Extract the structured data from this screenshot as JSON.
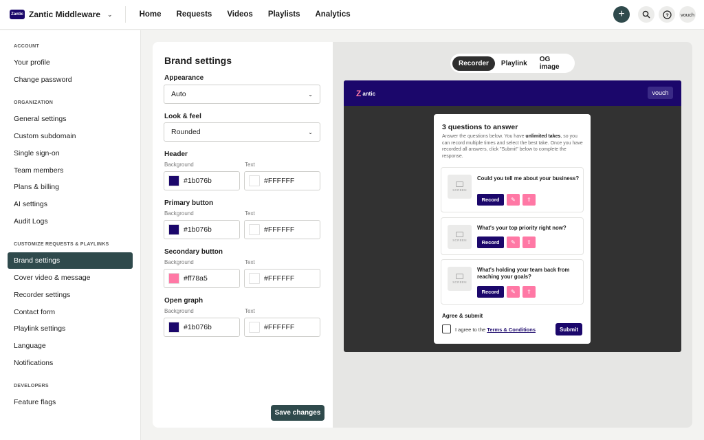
{
  "topbar": {
    "org_logo_text": "Zantic",
    "org_name": "Zantic Middleware",
    "nav": [
      "Home",
      "Requests",
      "Videos",
      "Playlists",
      "Analytics"
    ],
    "user_label": "vouch"
  },
  "sidebar": {
    "sections": [
      {
        "title": "ACCOUNT",
        "items": [
          "Your profile",
          "Change password"
        ]
      },
      {
        "title": "ORGANIZATION",
        "items": [
          "General settings",
          "Custom subdomain",
          "Single sign-on",
          "Team members",
          "Plans & billing",
          "AI settings",
          "Audit Logs"
        ]
      },
      {
        "title": "CUSTOMIZE REQUESTS & PLAYLINKS",
        "items": [
          "Brand settings",
          "Cover video & message",
          "Recorder settings",
          "Contact form",
          "Playlink settings",
          "Language",
          "Notifications"
        ]
      },
      {
        "title": "DEVELOPERS",
        "items": [
          "Feature flags"
        ]
      }
    ],
    "active_item": "Brand settings"
  },
  "form": {
    "title": "Brand settings",
    "appearance_label": "Appearance",
    "appearance_value": "Auto",
    "look_label": "Look & feel",
    "look_value": "Rounded",
    "background_label": "Background",
    "text_label": "Text",
    "groups": [
      {
        "label": "Header",
        "background": "#1b076b",
        "text": "#FFFFFF"
      },
      {
        "label": "Primary button",
        "background": "#1b076b",
        "text": "#FFFFFF"
      },
      {
        "label": "Secondary button",
        "background": "#ff78a5",
        "text": "#FFFFFF"
      },
      {
        "label": "Open graph",
        "background": "#1b076b",
        "text": "#FFFFFF"
      }
    ],
    "save_label": "Save changes"
  },
  "preview": {
    "tabs": [
      "Recorder",
      "Playlink",
      "OG image"
    ],
    "active_tab": "Recorder",
    "logo_text": "antic",
    "logo_letter": "Z",
    "vouch_label": "vouch",
    "card_title": "3 questions to answer",
    "desc_1": "Answer the questions below. You have ",
    "desc_bold": "unlimited takes",
    "desc_2": ", so you can record multiple times and select the best take. Once you have recorded all answers, click \"Submit\" below to complete the response.",
    "thumb_label": "SCREEN",
    "record_label": "Record",
    "questions": [
      "Could you tell me about your business?",
      "What's your top priority right now?",
      "What's holding your team back from reaching your goals?"
    ],
    "agree_title": "Agree & submit",
    "agree_prefix": "I agree to the ",
    "agree_link": "Terms & Conditions",
    "submit_label": "Submit"
  }
}
